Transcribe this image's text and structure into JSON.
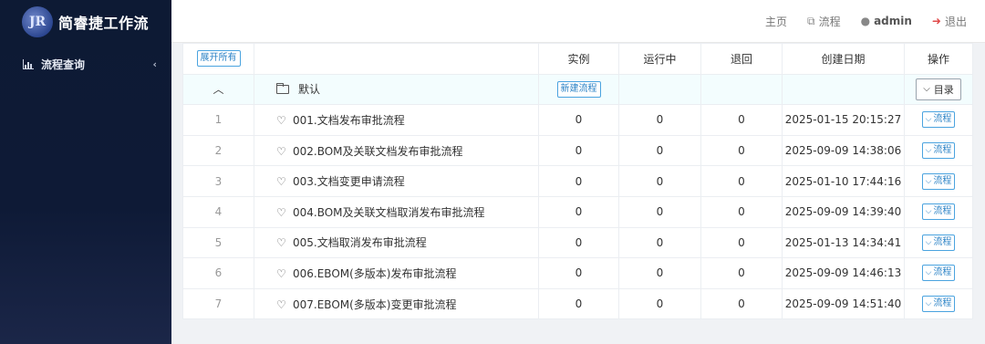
{
  "app": {
    "title": "简睿捷工作流",
    "logo_text": "JR"
  },
  "sidebar": {
    "items": [
      {
        "label": "流程查询"
      }
    ]
  },
  "header": {
    "home": "主页",
    "flow": "流程",
    "user": "admin",
    "logout": "退出"
  },
  "table": {
    "expand_all": "展开所有",
    "columns": [
      "实例",
      "运行中",
      "退回",
      "创建日期",
      "操作"
    ],
    "group": {
      "name": "默认",
      "new_button": "新建流程",
      "dir_button": "目录"
    },
    "row_action": "流程",
    "rows": [
      {
        "index": "1",
        "name": "001.文档发布审批流程",
        "instances": "0",
        "running": "0",
        "returned": "0",
        "created": "2025-01-15 20:15:27"
      },
      {
        "index": "2",
        "name": "002.BOM及关联文档发布审批流程",
        "instances": "0",
        "running": "0",
        "returned": "0",
        "created": "2025-09-09 14:38:06"
      },
      {
        "index": "3",
        "name": "003.文档变更申请流程",
        "instances": "0",
        "running": "0",
        "returned": "0",
        "created": "2025-01-10 17:44:16"
      },
      {
        "index": "4",
        "name": "004.BOM及关联文档取消发布审批流程",
        "instances": "0",
        "running": "0",
        "returned": "0",
        "created": "2025-09-09 14:39:40"
      },
      {
        "index": "5",
        "name": "005.文档取消发布审批流程",
        "instances": "0",
        "running": "0",
        "returned": "0",
        "created": "2025-01-13 14:34:41"
      },
      {
        "index": "6",
        "name": "006.EBOM(多版本)发布审批流程",
        "instances": "0",
        "running": "0",
        "returned": "0",
        "created": "2025-09-09 14:46:13"
      },
      {
        "index": "7",
        "name": "007.EBOM(多版本)变更审批流程",
        "instances": "0",
        "running": "0",
        "returned": "0",
        "created": "2025-09-09 14:51:40"
      }
    ]
  }
}
